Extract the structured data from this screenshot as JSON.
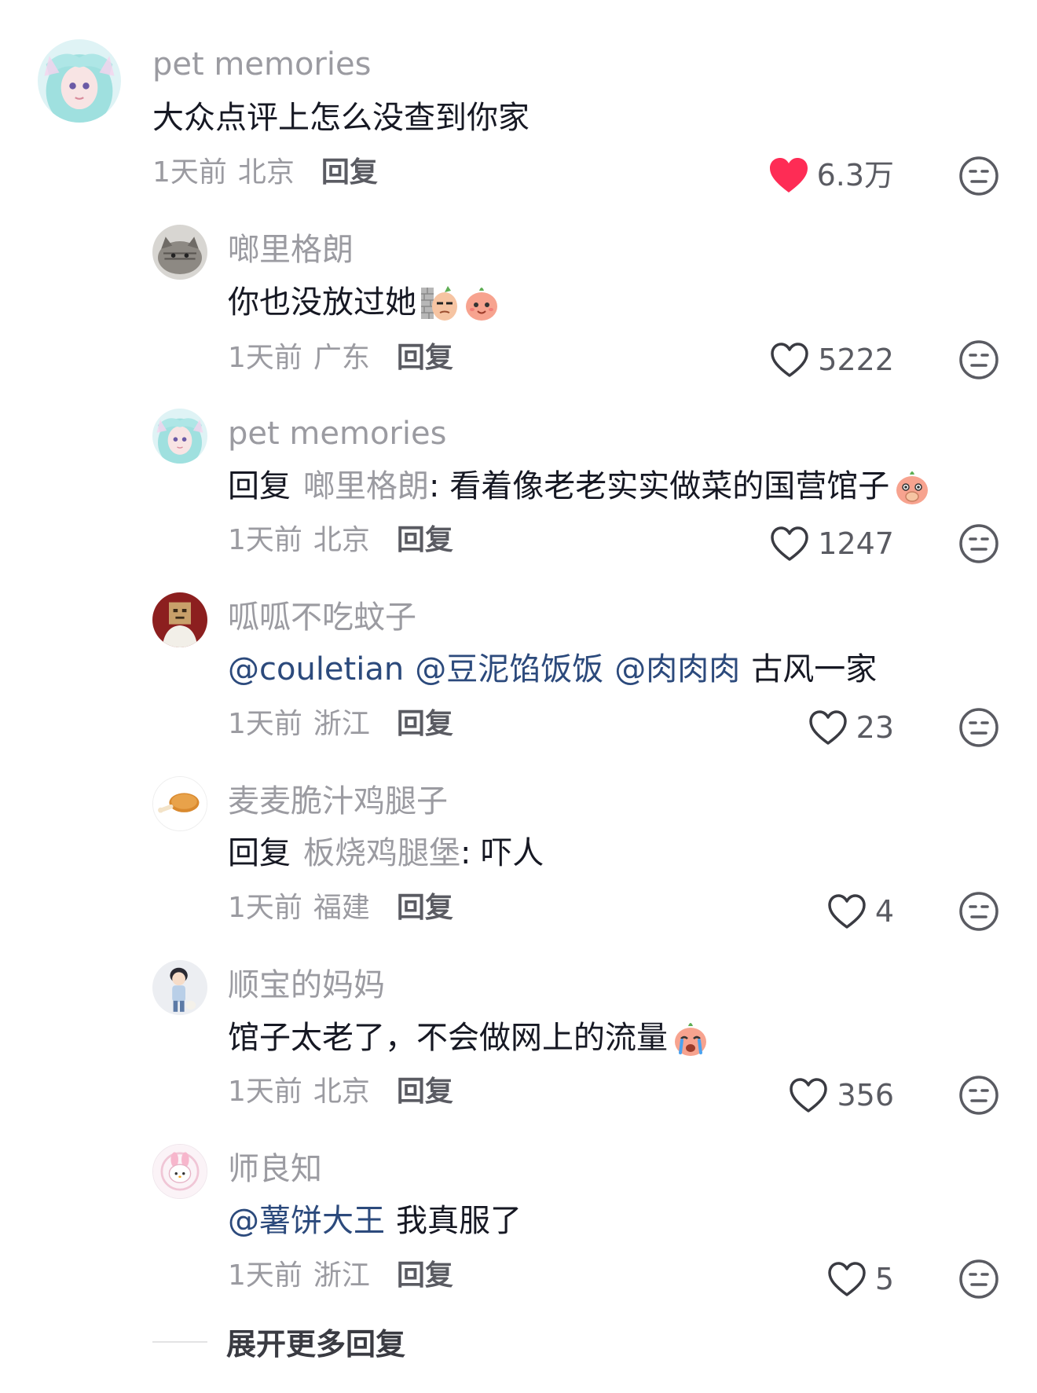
{
  "comments": [
    {
      "name": "pet memories",
      "text": "大众点评上怎么没查到你家",
      "time": "1天前",
      "location": "北京",
      "reply_label": "回复",
      "likes": "6.3万",
      "liked": true,
      "avatar": "anime-girl-avatar"
    },
    {
      "name": "啷里格朗",
      "text": "你也没放过她",
      "emojis": [
        "wall-peek-emoji",
        "peach-smile-emoji"
      ],
      "time": "1天前",
      "location": "广东",
      "reply_label": "回复",
      "likes": "5222",
      "liked": false,
      "avatar": "cat-avatar"
    },
    {
      "name": "pet memories",
      "reply_word": "回复",
      "reply_target": "啷里格朗",
      "text": ": 看着像老老实实做菜的国营馆子",
      "emojis": [
        "peach-cover-mouth-emoji"
      ],
      "time": "1天前",
      "location": "北京",
      "reply_label": "回复",
      "likes": "1247",
      "liked": false,
      "avatar": "anime-girl-avatar"
    },
    {
      "name": "呱呱不吃蚊子",
      "mentions": [
        "@couletian",
        "@豆泥馅饭饭",
        "@肉肉肉"
      ],
      "text": "古风一家",
      "time": "1天前",
      "location": "浙江",
      "reply_label": "回复",
      "likes": "23",
      "liked": false,
      "avatar": "paper-bag-head-avatar"
    },
    {
      "name": "麦麦脆汁鸡腿子",
      "reply_word": "回复",
      "reply_target": "板烧鸡腿堡",
      "text": ": 吓人",
      "time": "1天前",
      "location": "福建",
      "reply_label": "回复",
      "likes": "4",
      "liked": false,
      "avatar": "fried-chicken-avatar"
    },
    {
      "name": "顺宝的妈妈",
      "text": "馆子太老了，不会做网上的流量",
      "emojis": [
        "peach-crying-emoji"
      ],
      "time": "1天前",
      "location": "北京",
      "reply_label": "回复",
      "likes": "356",
      "liked": false,
      "avatar": "boy-with-cat-avatar"
    },
    {
      "name": "师良知",
      "mentions": [
        "@薯饼大王"
      ],
      "text": "我真服了",
      "time": "1天前",
      "location": "浙江",
      "reply_label": "回复",
      "likes": "5",
      "liked": false,
      "avatar": "melody-bunny-avatar"
    }
  ],
  "expand_label": "展开更多回复",
  "colors": {
    "liked_heart": "#fe2c55",
    "mention": "#2c4a7c",
    "secondary_text": "#9b9ba1"
  }
}
